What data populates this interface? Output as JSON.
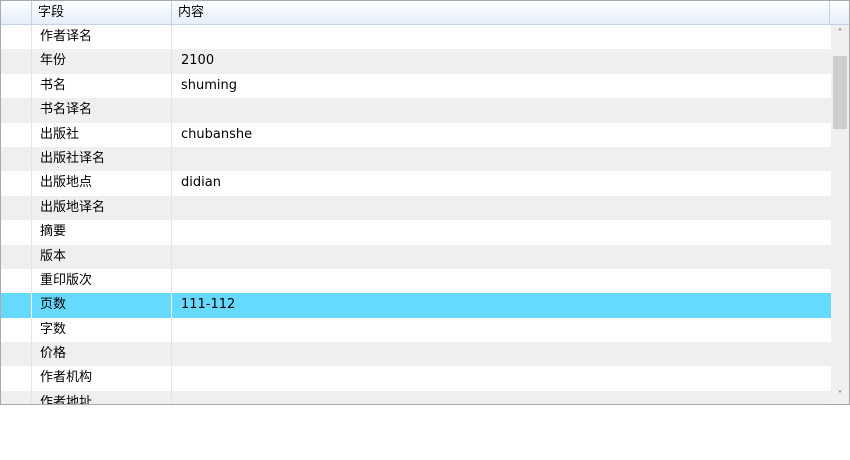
{
  "columns": {
    "field": "字段",
    "content": "内容"
  },
  "rows": [
    {
      "field": "作者译名",
      "value": ""
    },
    {
      "field": "年份",
      "value": "2100"
    },
    {
      "field": "书名",
      "value": "shuming"
    },
    {
      "field": "书名译名",
      "value": ""
    },
    {
      "field": "出版社",
      "value": "chubanshe"
    },
    {
      "field": "出版社译名",
      "value": ""
    },
    {
      "field": "出版地点",
      "value": "didian"
    },
    {
      "field": "出版地译名",
      "value": ""
    },
    {
      "field": "摘要",
      "value": ""
    },
    {
      "field": "版本",
      "value": ""
    },
    {
      "field": "重印版次",
      "value": ""
    },
    {
      "field": "页数",
      "value": "111-112",
      "selected": true
    },
    {
      "field": "字数",
      "value": ""
    },
    {
      "field": "价格",
      "value": ""
    },
    {
      "field": "作者机构",
      "value": ""
    },
    {
      "field": "作者地址",
      "value": ""
    }
  ],
  "scrollbar": {
    "up_icon": "chevron-up-icon",
    "down_icon": "chevron-down-icon"
  },
  "colors": {
    "selected": "#66d9ff",
    "alt_row": "#efefef"
  }
}
